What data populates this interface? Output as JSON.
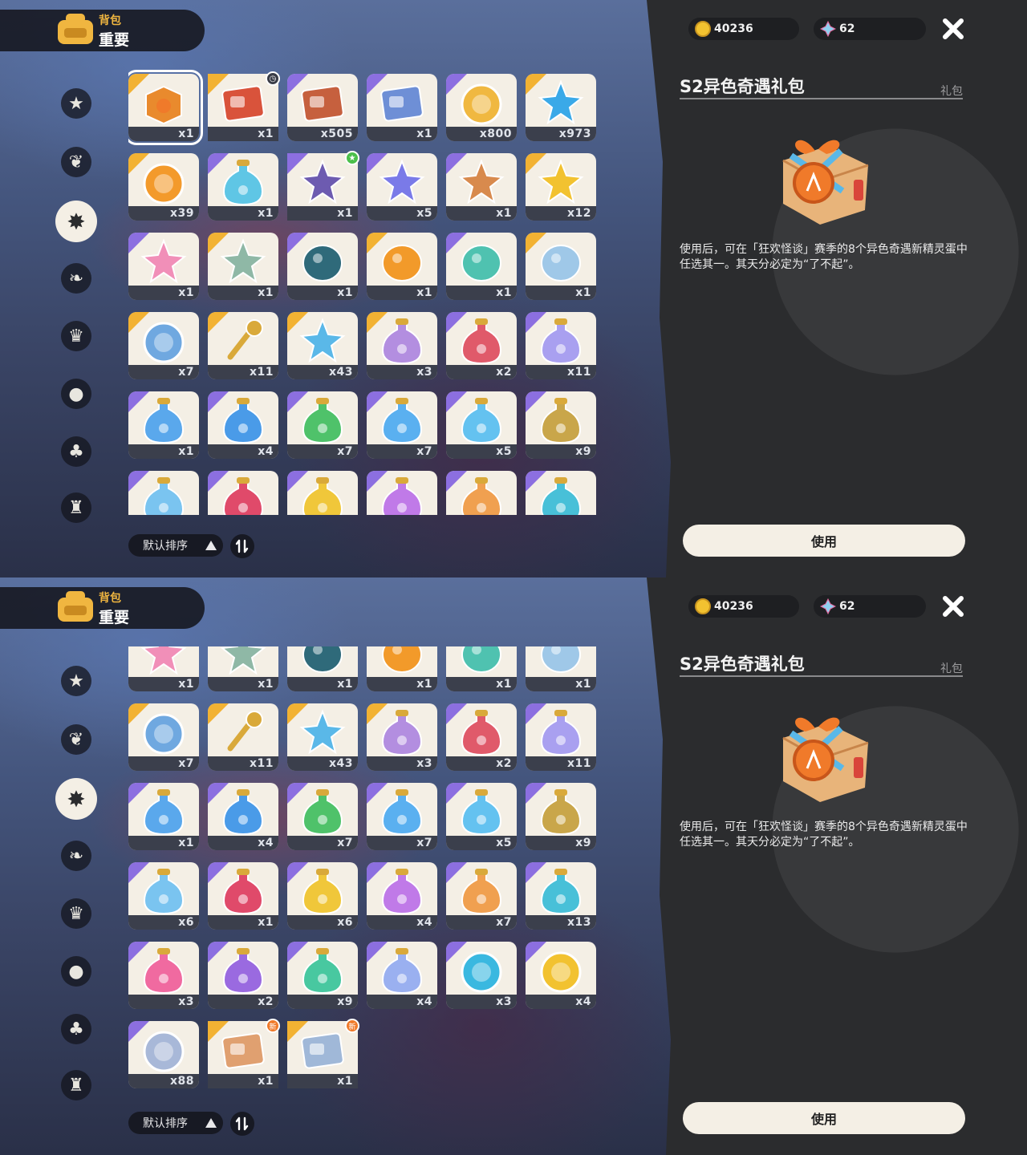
{
  "header": {
    "title_small": "背包",
    "title_big": "重要"
  },
  "categories": [
    "star-badge-icon",
    "leaf-icon",
    "sparkle-star-icon",
    "dice-leaf-icon",
    "crown-card-icon",
    "cookie-icon",
    "acorn-icon",
    "sofa-icon"
  ],
  "sort": {
    "label": "默认排序"
  },
  "currency": {
    "gold": "40236",
    "gem": "62"
  },
  "detail": {
    "title": "S2异色奇遇礼包",
    "type": "礼包",
    "description": "使用后，可在「狂欢怪谈」赛季的8个异色奇遇新精灵蛋中任选其一。其天分必定为“了不起”。",
    "use_button": "使用"
  },
  "colors": {
    "accent_gold": "#f2b233",
    "accent_purple": "#8c6fe0",
    "panel_bg": "#2b2c2e",
    "cell_bg": "#f4efe5"
  },
  "screen1_items": [
    {
      "name": "gift-box",
      "count": "x1",
      "rarity": "gold",
      "color": "#e98a2d",
      "sel": true
    },
    {
      "name": "ticket-card",
      "count": "x1",
      "rarity": "gold",
      "color": "#d9533b",
      "badge": "clock"
    },
    {
      "name": "rabbit-card",
      "count": "x505",
      "rarity": "purple",
      "color": "#c6603e"
    },
    {
      "name": "id-card",
      "count": "x1",
      "rarity": "purple",
      "color": "#6e8fd6"
    },
    {
      "name": "gold-coin-camera",
      "count": "x800",
      "rarity": "purple",
      "color": "#f0b840"
    },
    {
      "name": "blue-crystal",
      "count": "x973",
      "rarity": "gold",
      "color": "#3aa9e8"
    },
    {
      "name": "orange-medal",
      "count": "x39",
      "rarity": "gold",
      "color": "#f39a2b"
    },
    {
      "name": "water-bottle",
      "count": "x1",
      "rarity": "purple",
      "color": "#5fc6e5"
    },
    {
      "name": "star-pouch",
      "count": "x1",
      "rarity": "purple",
      "color": "#6d5bb0",
      "badge": "green"
    },
    {
      "name": "purple-gem",
      "count": "x5",
      "rarity": "purple",
      "color": "#7a7ae8"
    },
    {
      "name": "star-box",
      "count": "x1",
      "rarity": "purple",
      "color": "#d88a4d"
    },
    {
      "name": "gold-star",
      "count": "x12",
      "rarity": "gold",
      "color": "#f2c230"
    },
    {
      "name": "pink-star-crystal",
      "count": "x1",
      "rarity": "purple",
      "color": "#f18fb8"
    },
    {
      "name": "crown-crystal",
      "count": "x1",
      "rarity": "gold",
      "color": "#8fb8a6"
    },
    {
      "name": "night-egg",
      "count": "x1",
      "rarity": "purple",
      "color": "#2f6a7a"
    },
    {
      "name": "flame-flower",
      "count": "x1",
      "rarity": "gold",
      "color": "#f29a2a"
    },
    {
      "name": "fox-mask",
      "count": "x1",
      "rarity": "purple",
      "color": "#4fc2b0"
    },
    {
      "name": "mirror",
      "count": "x1",
      "rarity": "gold",
      "color": "#9fc8e8"
    },
    {
      "name": "blue-ring",
      "count": "x7",
      "rarity": "gold",
      "color": "#6fa8e0"
    },
    {
      "name": "gold-key",
      "count": "x11",
      "rarity": "gold",
      "color": "#d9a93a"
    },
    {
      "name": "star-wand",
      "count": "x43",
      "rarity": "gold",
      "color": "#5ab8e8"
    },
    {
      "name": "rainbow-potion",
      "count": "x3",
      "rarity": "gold",
      "color": "#b38ee0"
    },
    {
      "name": "red-potion",
      "count": "x2",
      "rarity": "purple",
      "color": "#e05a6a"
    },
    {
      "name": "crystal-potion",
      "count": "x11",
      "rarity": "purple",
      "color": "#a9a0f0"
    },
    {
      "name": "blue-flask",
      "count": "x1",
      "rarity": "purple",
      "color": "#5aa8ec"
    },
    {
      "name": "blue-potion",
      "count": "x4",
      "rarity": "purple",
      "color": "#4a9be8"
    },
    {
      "name": "green-potion",
      "count": "x7",
      "rarity": "purple",
      "color": "#4fc26a"
    },
    {
      "name": "azure-potion",
      "count": "x7",
      "rarity": "purple",
      "color": "#5ab0f0"
    },
    {
      "name": "sky-potion",
      "count": "x5",
      "rarity": "purple",
      "color": "#64c2f0"
    },
    {
      "name": "gold-potion",
      "count": "x9",
      "rarity": "purple",
      "color": "#c9a64a"
    },
    {
      "name": "ice-potion",
      "count": "",
      "rarity": "purple",
      "color": "#7ac4f0"
    },
    {
      "name": "ruby-potion",
      "count": "",
      "rarity": "purple",
      "color": "#e04a6a"
    },
    {
      "name": "amber-potion",
      "count": "",
      "rarity": "purple",
      "color": "#f0c73a"
    },
    {
      "name": "violet-potion",
      "count": "",
      "rarity": "purple",
      "color": "#c07ae8"
    },
    {
      "name": "orange-potion",
      "count": "",
      "rarity": "purple",
      "color": "#f0a050"
    },
    {
      "name": "teal-potion",
      "count": "",
      "rarity": "purple",
      "color": "#48c0d8"
    }
  ],
  "screen2_items": [
    {
      "name": "pink-star-crystal",
      "count": "x1",
      "rarity": "purple",
      "color": "#f18fb8"
    },
    {
      "name": "crown-crystal",
      "count": "x1",
      "rarity": "gold",
      "color": "#8fb8a6"
    },
    {
      "name": "night-egg",
      "count": "x1",
      "rarity": "purple",
      "color": "#2f6a7a"
    },
    {
      "name": "flame-flower",
      "count": "x1",
      "rarity": "gold",
      "color": "#f29a2a"
    },
    {
      "name": "fox-mask",
      "count": "x1",
      "rarity": "purple",
      "color": "#4fc2b0"
    },
    {
      "name": "mirror",
      "count": "x1",
      "rarity": "gold",
      "color": "#9fc8e8"
    },
    {
      "name": "blue-ring",
      "count": "x7",
      "rarity": "gold",
      "color": "#6fa8e0"
    },
    {
      "name": "gold-key",
      "count": "x11",
      "rarity": "gold",
      "color": "#d9a93a"
    },
    {
      "name": "star-wand",
      "count": "x43",
      "rarity": "gold",
      "color": "#5ab8e8"
    },
    {
      "name": "rainbow-potion",
      "count": "x3",
      "rarity": "gold",
      "color": "#b38ee0"
    },
    {
      "name": "red-potion",
      "count": "x2",
      "rarity": "purple",
      "color": "#e05a6a"
    },
    {
      "name": "crystal-potion",
      "count": "x11",
      "rarity": "purple",
      "color": "#a9a0f0"
    },
    {
      "name": "blue-flask",
      "count": "x1",
      "rarity": "purple",
      "color": "#5aa8ec"
    },
    {
      "name": "blue-potion",
      "count": "x4",
      "rarity": "purple",
      "color": "#4a9be8"
    },
    {
      "name": "green-potion",
      "count": "x7",
      "rarity": "purple",
      "color": "#4fc26a"
    },
    {
      "name": "azure-potion",
      "count": "x7",
      "rarity": "purple",
      "color": "#5ab0f0"
    },
    {
      "name": "sky-potion",
      "count": "x5",
      "rarity": "purple",
      "color": "#64c2f0"
    },
    {
      "name": "gold-potion",
      "count": "x9",
      "rarity": "purple",
      "color": "#c9a64a"
    },
    {
      "name": "ice-potion",
      "count": "x6",
      "rarity": "purple",
      "color": "#7ac4f0"
    },
    {
      "name": "ruby-potion",
      "count": "x1",
      "rarity": "purple",
      "color": "#e04a6a"
    },
    {
      "name": "amber-potion",
      "count": "x6",
      "rarity": "purple",
      "color": "#f0c73a"
    },
    {
      "name": "violet-potion",
      "count": "x4",
      "rarity": "purple",
      "color": "#c07ae8"
    },
    {
      "name": "orange-potion",
      "count": "x7",
      "rarity": "purple",
      "color": "#f0a050"
    },
    {
      "name": "teal-potion",
      "count": "x13",
      "rarity": "purple",
      "color": "#48c0d8"
    },
    {
      "name": "heart-potion",
      "count": "x3",
      "rarity": "purple",
      "color": "#f06aa0"
    },
    {
      "name": "moon-potion",
      "count": "x2",
      "rarity": "purple",
      "color": "#9a6ae0"
    },
    {
      "name": "mint-potion",
      "count": "x9",
      "rarity": "purple",
      "color": "#48c8a0"
    },
    {
      "name": "swirl-potion",
      "count": "x4",
      "rarity": "purple",
      "color": "#9ab0f0"
    },
    {
      "name": "blue-star-coin",
      "count": "x3",
      "rarity": "purple",
      "color": "#3ab8e0"
    },
    {
      "name": "gold-star-coin",
      "count": "x4",
      "rarity": "purple",
      "color": "#f2c230"
    },
    {
      "name": "silver-coin",
      "count": "x88",
      "rarity": "purple",
      "color": "#a8b8d8"
    },
    {
      "name": "fire-scroll",
      "count": "x1",
      "rarity": "gold",
      "color": "#e0a070",
      "badge": "new"
    },
    {
      "name": "water-scroll",
      "count": "x1",
      "rarity": "gold",
      "color": "#a0b8d8",
      "badge": "new"
    }
  ]
}
